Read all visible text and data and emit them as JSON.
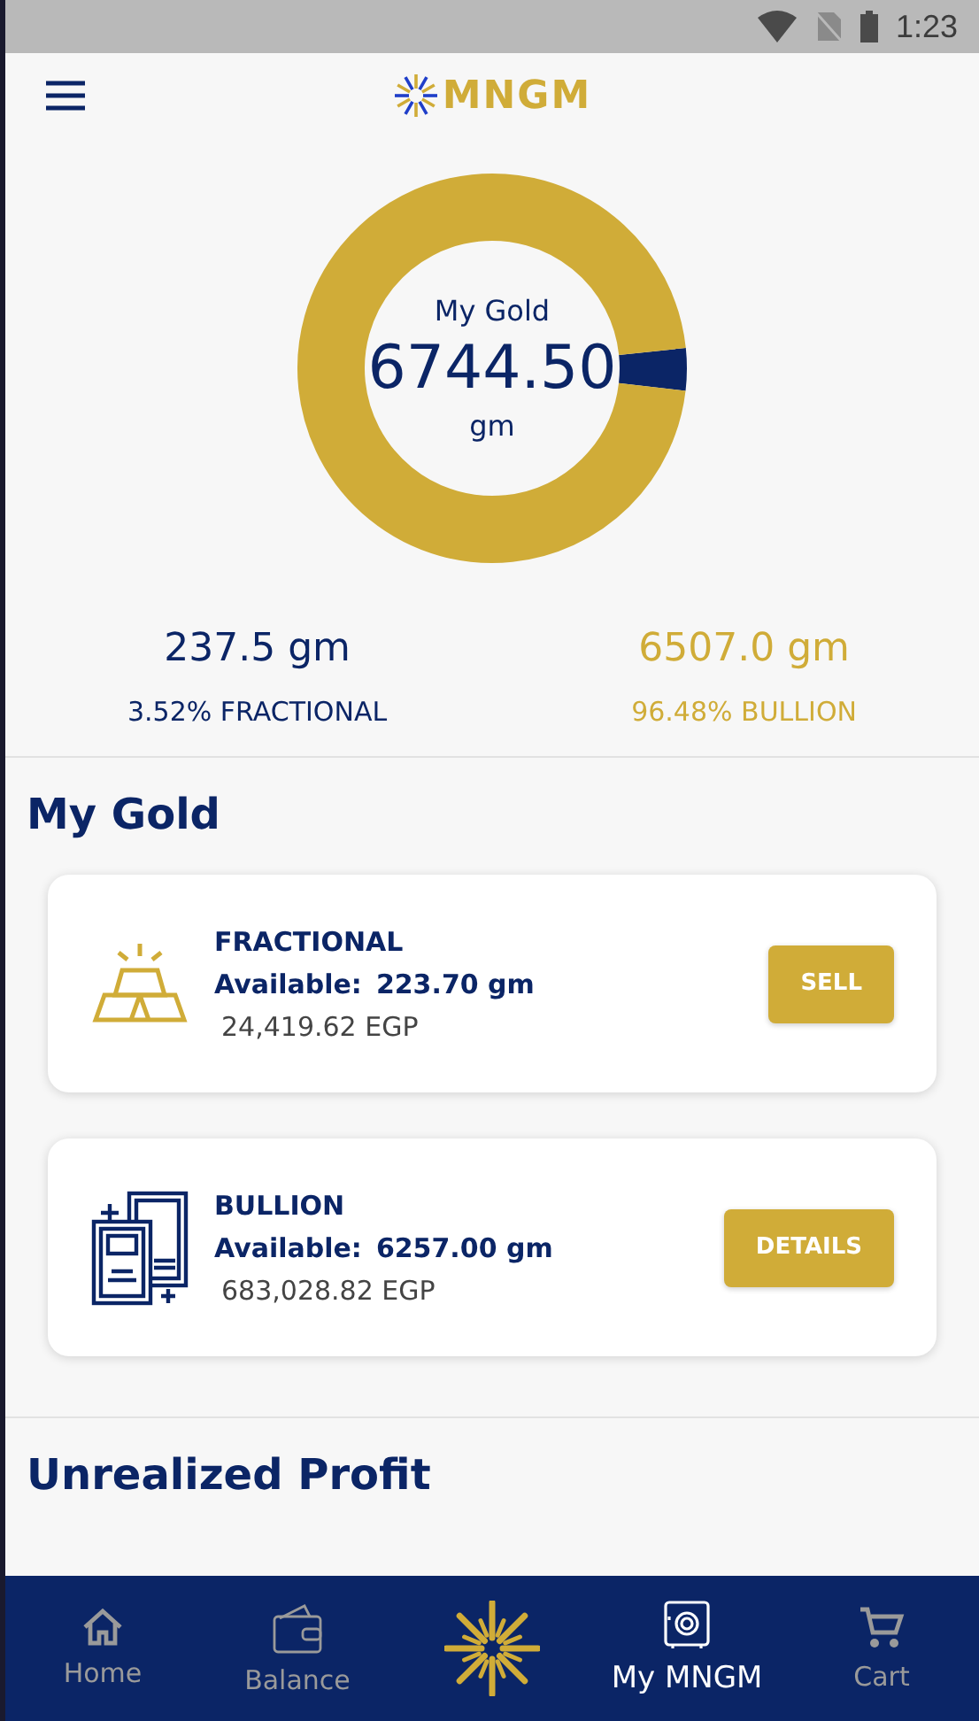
{
  "status_bar": {
    "time": "1:23"
  },
  "header": {
    "logo": "MNGM"
  },
  "summary": {
    "title": "My Gold",
    "total": "6744.50",
    "unit": "gm",
    "parts": [
      {
        "amount": "237.5 gm",
        "label": "3.52% FRACTIONAL",
        "color": "#0b2566"
      },
      {
        "amount": "6507.0 gm",
        "label": "96.48% BULLION",
        "color": "#d0ac38"
      }
    ]
  },
  "section_title": "My Gold",
  "holdings": [
    {
      "kind": "bars",
      "name": "FRACTIONAL",
      "available_label": "Available:",
      "available": "223.70 gm",
      "value": "24,419.62 EGP",
      "action": "SELL"
    },
    {
      "kind": "certificate",
      "name": "BULLION",
      "available_label": "Available:",
      "available": "6257.00 gm",
      "value": "683,028.82 EGP",
      "action": "DETAILS"
    }
  ],
  "next_section_title": "Unrealized Profit",
  "nav": [
    {
      "kind": "home",
      "label": "Home",
      "selected": false
    },
    {
      "kind": "wallet",
      "label": "Balance",
      "selected": false
    },
    {
      "kind": "sun"
    },
    {
      "kind": "safe",
      "label": "My MNGM",
      "selected": true
    },
    {
      "kind": "cart",
      "label": "Cart",
      "selected": false
    }
  ]
}
